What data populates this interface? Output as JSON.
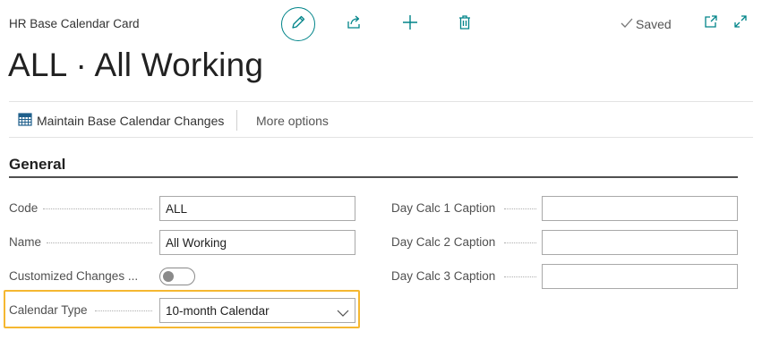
{
  "header": {
    "caption": "HR Base Calendar Card",
    "status": "Saved",
    "title": "ALL · All Working"
  },
  "toolbar": {
    "edit_icon": "pencil-icon",
    "share_icon": "share-icon",
    "new_icon": "plus-icon",
    "delete_icon": "trash-icon",
    "popout_icon": "open-new-window-icon",
    "expand_icon": "expand-icon"
  },
  "actions": {
    "maintain_label": "Maintain Base Calendar Changes",
    "more_label": "More options"
  },
  "section": {
    "title": "General"
  },
  "fields": {
    "code": {
      "label": "Code",
      "value": "ALL"
    },
    "name": {
      "label": "Name",
      "value": "All Working"
    },
    "customized": {
      "label": "Customized Changes ...",
      "checked": false
    },
    "calendar_type": {
      "label": "Calendar Type",
      "value": "10-month Calendar"
    },
    "day_calc_1": {
      "label": "Day Calc 1 Caption",
      "value": ""
    },
    "day_calc_2": {
      "label": "Day Calc 2 Caption",
      "value": ""
    },
    "day_calc_3": {
      "label": "Day Calc 3 Caption",
      "value": ""
    }
  },
  "colors": {
    "accent": "#008489",
    "highlight": "#f5b731",
    "text": "#212121",
    "label": "#505050"
  }
}
